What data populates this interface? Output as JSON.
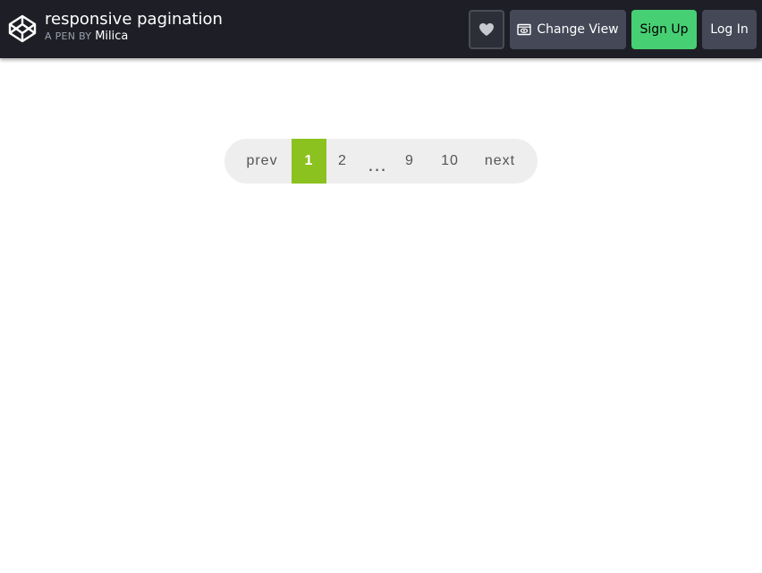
{
  "header": {
    "title": "responsive pagination",
    "by_label": "A PEN BY",
    "author": "Milica",
    "buttons": {
      "change_view": "Change View",
      "sign_up": "Sign Up",
      "log_in": "Log In"
    },
    "icons": {
      "logo": "codepen-logo-icon",
      "heart": "heart-icon",
      "view": "eye-icon"
    },
    "colors": {
      "bar": "#1e1f26",
      "button": "#444857",
      "signup": "#47cf73"
    }
  },
  "pagination": {
    "prev": "prev",
    "pages": [
      "1",
      "2",
      "9",
      "10"
    ],
    "ellipsis": "...",
    "next": "next",
    "active": "1",
    "colors": {
      "active": "#8bc220",
      "background": "#eeeeee",
      "text": "#555555"
    }
  }
}
